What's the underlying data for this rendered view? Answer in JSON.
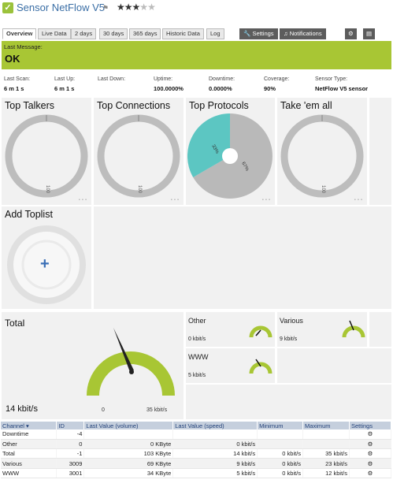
{
  "header": {
    "title": "Sensor NetFlow V5",
    "flag_icon": "flag-icon",
    "rating": {
      "value": 3,
      "max": 5
    }
  },
  "tabs": [
    "Overview",
    "Live Data",
    "2 days",
    "30 days",
    "365 days",
    "Historic Data",
    "Log"
  ],
  "actions": {
    "settings": "Settings",
    "notifications": "Notifications"
  },
  "last_message": {
    "label": "Last Message:",
    "value": "OK"
  },
  "stats": [
    {
      "label": "Last Scan:",
      "value": "6 m 1 s"
    },
    {
      "label": "Last Up:",
      "value": "6 m 1 s"
    },
    {
      "label": "Last Down:",
      "value": ""
    },
    {
      "label": "Uptime:",
      "value": "100.0000%"
    },
    {
      "label": "Downtime:",
      "value": "0.0000%"
    },
    {
      "label": "Coverage:",
      "value": "90%"
    },
    {
      "label": "Sensor Type:",
      "value": "NetFlow V5 sensor"
    }
  ],
  "toplists": {
    "talkers": {
      "title": "Top Talkers",
      "label": "100"
    },
    "connections": {
      "title": "Top Connections",
      "label": "100"
    },
    "protocols": {
      "title": "Top Protocols",
      "slice_a": "33%",
      "slice_b": "67%"
    },
    "take_em_all": {
      "title": "Take 'em all",
      "label": "100"
    },
    "add": {
      "title": "Add Toplist"
    }
  },
  "total": {
    "title": "Total",
    "value": "14 kbit/s",
    "min": "0",
    "max": "35 kbit/s"
  },
  "mini_gauges": [
    {
      "title": "Other",
      "value": "0 kbit/s"
    },
    {
      "title": "Various",
      "value": "9 kbit/s"
    },
    {
      "title": "WWW",
      "value": "5 kbit/s"
    }
  ],
  "table": {
    "headers": [
      "Channel",
      "ID",
      "Last Value (volume)",
      "Last Value (speed)",
      "Minimum",
      "Maximum",
      "Settings"
    ],
    "rows": [
      [
        "Downtime",
        "-4",
        "",
        "",
        "",
        "",
        ""
      ],
      [
        "Other",
        "0",
        "0 KByte",
        "0 kbit/s",
        "",
        "",
        ""
      ],
      [
        "Total",
        "-1",
        "103 KByte",
        "14 kbit/s",
        "0 kbit/s",
        "35 kbit/s",
        ""
      ],
      [
        "Various",
        "3009",
        "69 KByte",
        "9 kbit/s",
        "0 kbit/s",
        "23 kbit/s",
        ""
      ],
      [
        "WWW",
        "3001",
        "34 KByte",
        "5 kbit/s",
        "0 kbit/s",
        "12 kbit/s",
        ""
      ]
    ]
  },
  "colors": {
    "status_ok": "#a8c634",
    "gauge": "#a8c634",
    "pie_teal": "#5cc6c2",
    "pie_gray": "#b9b9b9",
    "ring": "#bdbdbd"
  }
}
